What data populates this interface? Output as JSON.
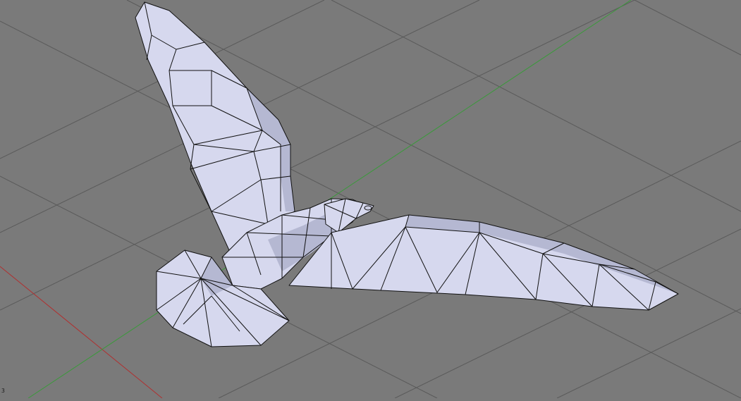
{
  "viewport": {
    "background_color": "#7a7a7a",
    "grid_color": "#5a5a5a",
    "x_axis_color": "#b03030",
    "y_axis_color": "#3a9a3a",
    "mesh_fill_color": "#d6d8ee",
    "mesh_shadow_color": "#b5b8d2",
    "wire_color": "#111111"
  },
  "scene": {
    "object": "bird-mesh",
    "corner_label": "3"
  }
}
